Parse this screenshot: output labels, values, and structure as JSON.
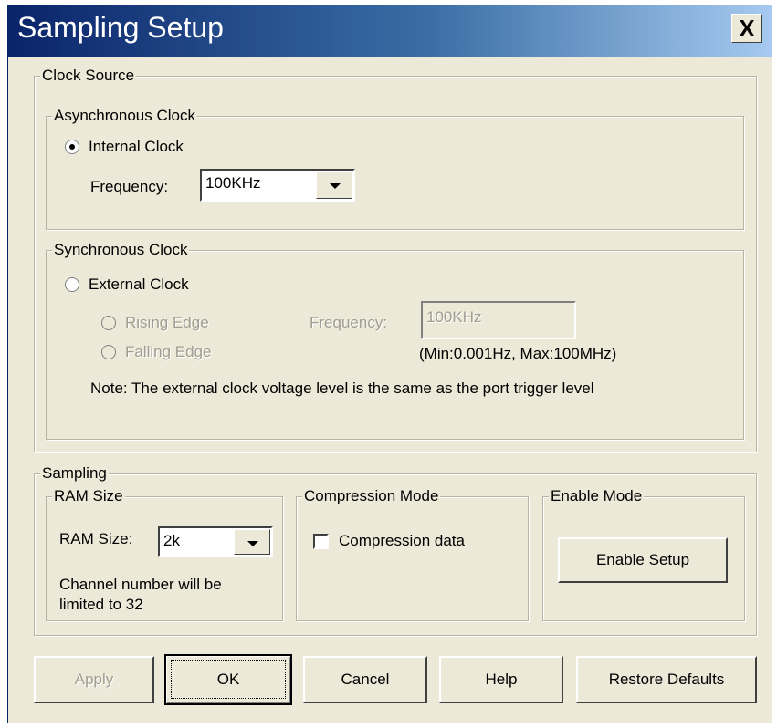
{
  "window": {
    "title": "Sampling Setup",
    "close_label": "X"
  },
  "clock_source": {
    "legend": "Clock Source",
    "async": {
      "legend": "Asynchronous Clock",
      "internal_label": "Internal Clock",
      "internal_selected": true,
      "frequency_label": "Frequency:",
      "frequency_value": "100KHz"
    },
    "sync": {
      "legend": "Synchronous Clock",
      "external_label": "External Clock",
      "rising_label": "Rising Edge",
      "falling_label": "Falling Edge",
      "frequency_label": "Frequency:",
      "frequency_value": "100KHz",
      "range_note": "(Min:0.001Hz, Max:100MHz)",
      "note": "Note: The external clock voltage level is the same as the port trigger level"
    }
  },
  "sampling": {
    "legend": "Sampling",
    "ram": {
      "legend": "RAM Size",
      "label": "RAM Size:",
      "value": "2k",
      "note_line1": "Channel number will be",
      "note_line2": "limited to 32"
    },
    "compression": {
      "legend": "Compression Mode",
      "checkbox_label": "Compression data",
      "checked": false
    },
    "enable": {
      "legend": "Enable Mode",
      "button_label": "Enable Setup"
    }
  },
  "buttons": {
    "apply": "Apply",
    "ok": "OK",
    "cancel": "Cancel",
    "help": "Help",
    "restore": "Restore Defaults"
  }
}
